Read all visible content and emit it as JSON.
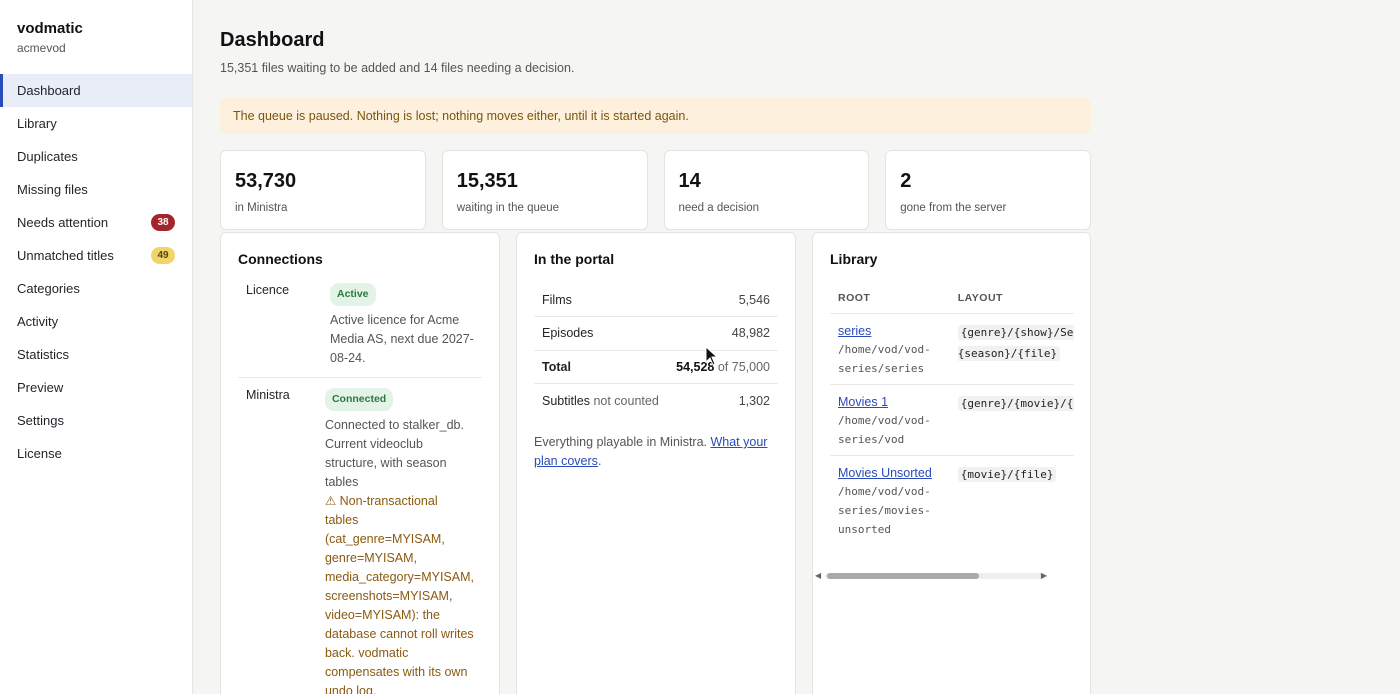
{
  "brand": {
    "name": "vodmatic",
    "sub": "acmevod"
  },
  "nav": [
    {
      "label": "Dashboard",
      "active": true
    },
    {
      "label": "Library"
    },
    {
      "label": "Duplicates"
    },
    {
      "label": "Missing files"
    },
    {
      "label": "Needs attention",
      "badge": "38",
      "badge_color": "#a4262c"
    },
    {
      "label": "Unmatched titles",
      "badge": "49",
      "badge_color": "#f1d46a"
    },
    {
      "label": "Categories"
    },
    {
      "label": "Activity"
    },
    {
      "label": "Statistics"
    },
    {
      "label": "Preview"
    },
    {
      "label": "Settings"
    },
    {
      "label": "License"
    }
  ],
  "header": {
    "title": "Dashboard",
    "subtitle": "15,351 files waiting to be added and 14 files needing a decision."
  },
  "notice": "The queue is paused. Nothing is lost; nothing moves either, until it is started again.",
  "stats": [
    {
      "value": "53,730",
      "label": "in Ministra"
    },
    {
      "value": "15,351",
      "label": "waiting in the queue"
    },
    {
      "value": "14",
      "label": "need a decision"
    },
    {
      "value": "2",
      "label": "gone from the server"
    }
  ],
  "connections": {
    "title": "Connections",
    "licence": {
      "name": "Licence",
      "status": "Active",
      "text": "Active licence for Acme Media AS, next due 2027-08-24."
    },
    "ministra": {
      "name": "Ministra",
      "status": "Connected",
      "text": "Connected to stalker_db. Current videoclub structure, with season tables",
      "warning": "⚠ Non-transactional tables (cat_genre=MYISAM, genre=MYISAM, media_category=MYISAM, screenshots=MYISAM, video=MYISAM): the database cannot roll writes back. vodmatic compensates with its own undo log."
    }
  },
  "portal": {
    "title": "In the portal",
    "films_label": "Films",
    "films_value": "5,546",
    "episodes_label": "Episodes",
    "episodes_value": "48,982",
    "total_label": "Total",
    "total_value": "54,528",
    "total_of": "of 75,000",
    "subtitles_label": "Subtitles",
    "subtitles_note": "not counted",
    "subtitles_value": "1,302",
    "note": "Everything playable in Ministra.",
    "note_link": "What your plan covers",
    "note_end": "."
  },
  "library": {
    "title": "Library",
    "col_root": "ROOT",
    "col_layout": "LAYOUT",
    "rows": [
      {
        "name": "series",
        "path": "/home/vod/vod-series/series",
        "layout": "{genre}/{show}/Season {season}/{file}"
      },
      {
        "name": "Movies 1",
        "path": "/home/vod/vod-series/vod",
        "layout": "{genre}/{movie}/{file}"
      },
      {
        "name": "Movies Unsorted",
        "path": "/home/vod/vod-series/movies-unsorted",
        "layout": "{movie}/{file}"
      }
    ]
  }
}
